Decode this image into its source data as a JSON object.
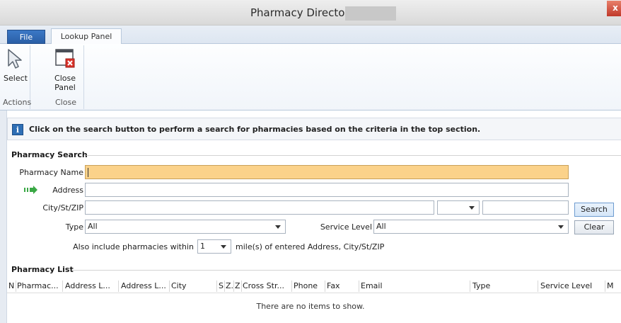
{
  "window": {
    "title": "Pharmacy Directory",
    "close_glyph": "x"
  },
  "ribbon_tabs": {
    "file": "File",
    "lookup_panel": "Lookup Panel"
  },
  "ribbon": {
    "select_label": "Select",
    "close_panel_label_line1": "Close",
    "close_panel_label_line2": "Panel",
    "group_actions": "Actions",
    "group_close": "Close"
  },
  "info": {
    "icon_glyph": "i",
    "message": "Click on the search button to perform a search for pharmacies based on the criteria in the top section."
  },
  "search": {
    "section_title": "Pharmacy Search",
    "pharmacy_name_label": "Pharmacy Name",
    "pharmacy_name_value": "",
    "address_label": "Address",
    "address_value": "",
    "city_label": "City/St/ZIP",
    "city_value": "",
    "state_value": "",
    "zip_value": "",
    "type_label": "Type",
    "type_value": "All",
    "service_level_label": "Service Level",
    "service_level_value": "All",
    "within_prefix": "Also include pharmacies within",
    "within_value": "1",
    "within_suffix": "mile(s) of entered Address, City/St/ZIP",
    "search_button": "Search",
    "clear_button": "Clear"
  },
  "list": {
    "section_title": "Pharmacy List",
    "columns": [
      "N",
      "Pharmac...",
      "Address L...",
      "Address L...",
      "City",
      "S",
      "Z.",
      "Z",
      "Cross Str...",
      "Phone",
      "Fax",
      "Email",
      "Type",
      "Service Level",
      "M"
    ],
    "empty_message": "There are no items to show."
  },
  "colors": {
    "focused_field": "#fbd28a",
    "file_tab": "#2a5fa6",
    "address_arrow": "#3aa845"
  },
  "icons": {
    "select": "cursor-arrow-icon",
    "close_panel": "window-close-icon",
    "info": "info-icon",
    "address_indicator": "green-arrow-icon"
  }
}
